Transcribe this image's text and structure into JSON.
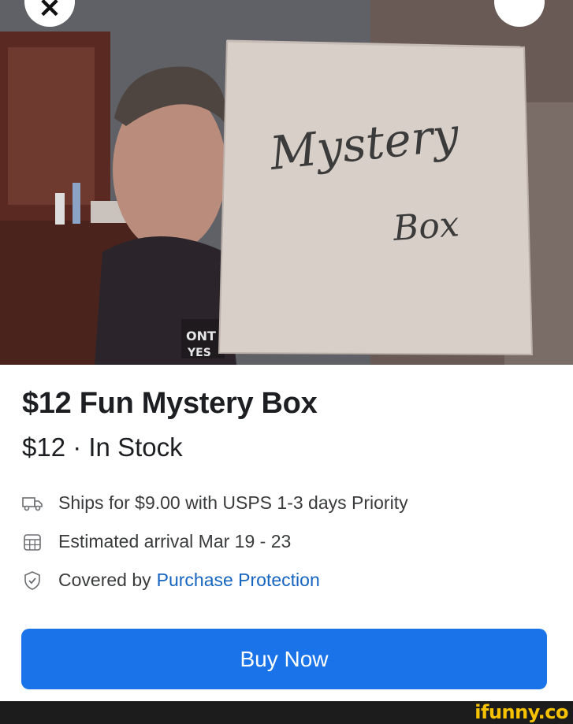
{
  "photo": {
    "box_text_line1": "Mystery",
    "box_text_line2": "Box",
    "shirt_text_line1": "ONT",
    "shirt_text_line2": "YES"
  },
  "nav": {
    "close_icon": "close-icon",
    "more_icon": "more-icon"
  },
  "listing": {
    "title": "$12 Fun Mystery Box",
    "price_status": "$12 · In Stock",
    "shipping": "Ships for $9.00 with USPS 1-3 days Priority",
    "arrival": "Estimated arrival Mar 19 - 23",
    "protection_prefix": "Covered by",
    "protection_link": "Purchase Protection",
    "buy_label": "Buy Now"
  },
  "watermark": "ifunny.co",
  "colors": {
    "accent": "#1a73e8",
    "link": "#1565c0",
    "watermark": "#f7c300"
  }
}
